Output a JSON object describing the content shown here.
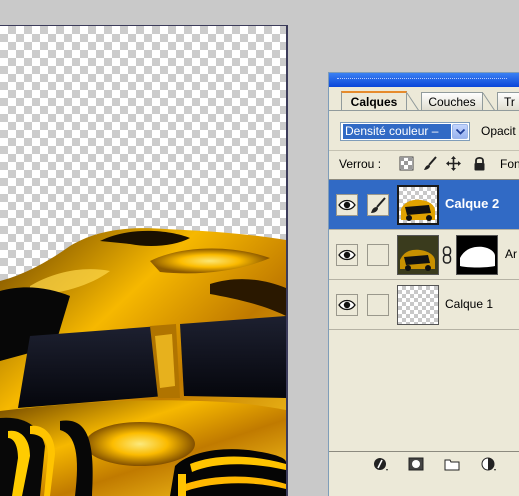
{
  "layers_panel": {
    "tabs": [
      {
        "label": "Calques",
        "active": true
      },
      {
        "label": "Couches",
        "active": false
      },
      {
        "label": "Tr",
        "active": false
      }
    ],
    "blend_mode": {
      "value": "Densité couleur –"
    },
    "opacity_label": "Opacit",
    "lock": {
      "label": "Verrou :",
      "icons": [
        "lock-transparency-icon",
        "lock-paint-brush-icon",
        "lock-move-icon",
        "lock-all-padlock-icon"
      ]
    },
    "fill_label": "Fon",
    "layers": [
      {
        "name": "Calque 2",
        "selected": true,
        "visible": true,
        "linked_icon": "brush-icon",
        "thumbnail": "car-transparent"
      },
      {
        "name": "Ar",
        "selected": false,
        "visible": true,
        "has_mask": true,
        "thumbnail": "car-opaque"
      },
      {
        "name": "Calque 1",
        "selected": false,
        "visible": true,
        "thumbnail": "transparent"
      }
    ],
    "bottom_icons": [
      "layer-style-icon",
      "add-mask-icon",
      "new-group-icon",
      "adjustment-layer-icon"
    ]
  },
  "colors": {
    "selection": "#316ac5",
    "panel_bg": "#ece9d8",
    "workspace_bg": "#c9c9c9",
    "car_gold": "#f2b100",
    "car_dark": "#0a0a0a"
  }
}
